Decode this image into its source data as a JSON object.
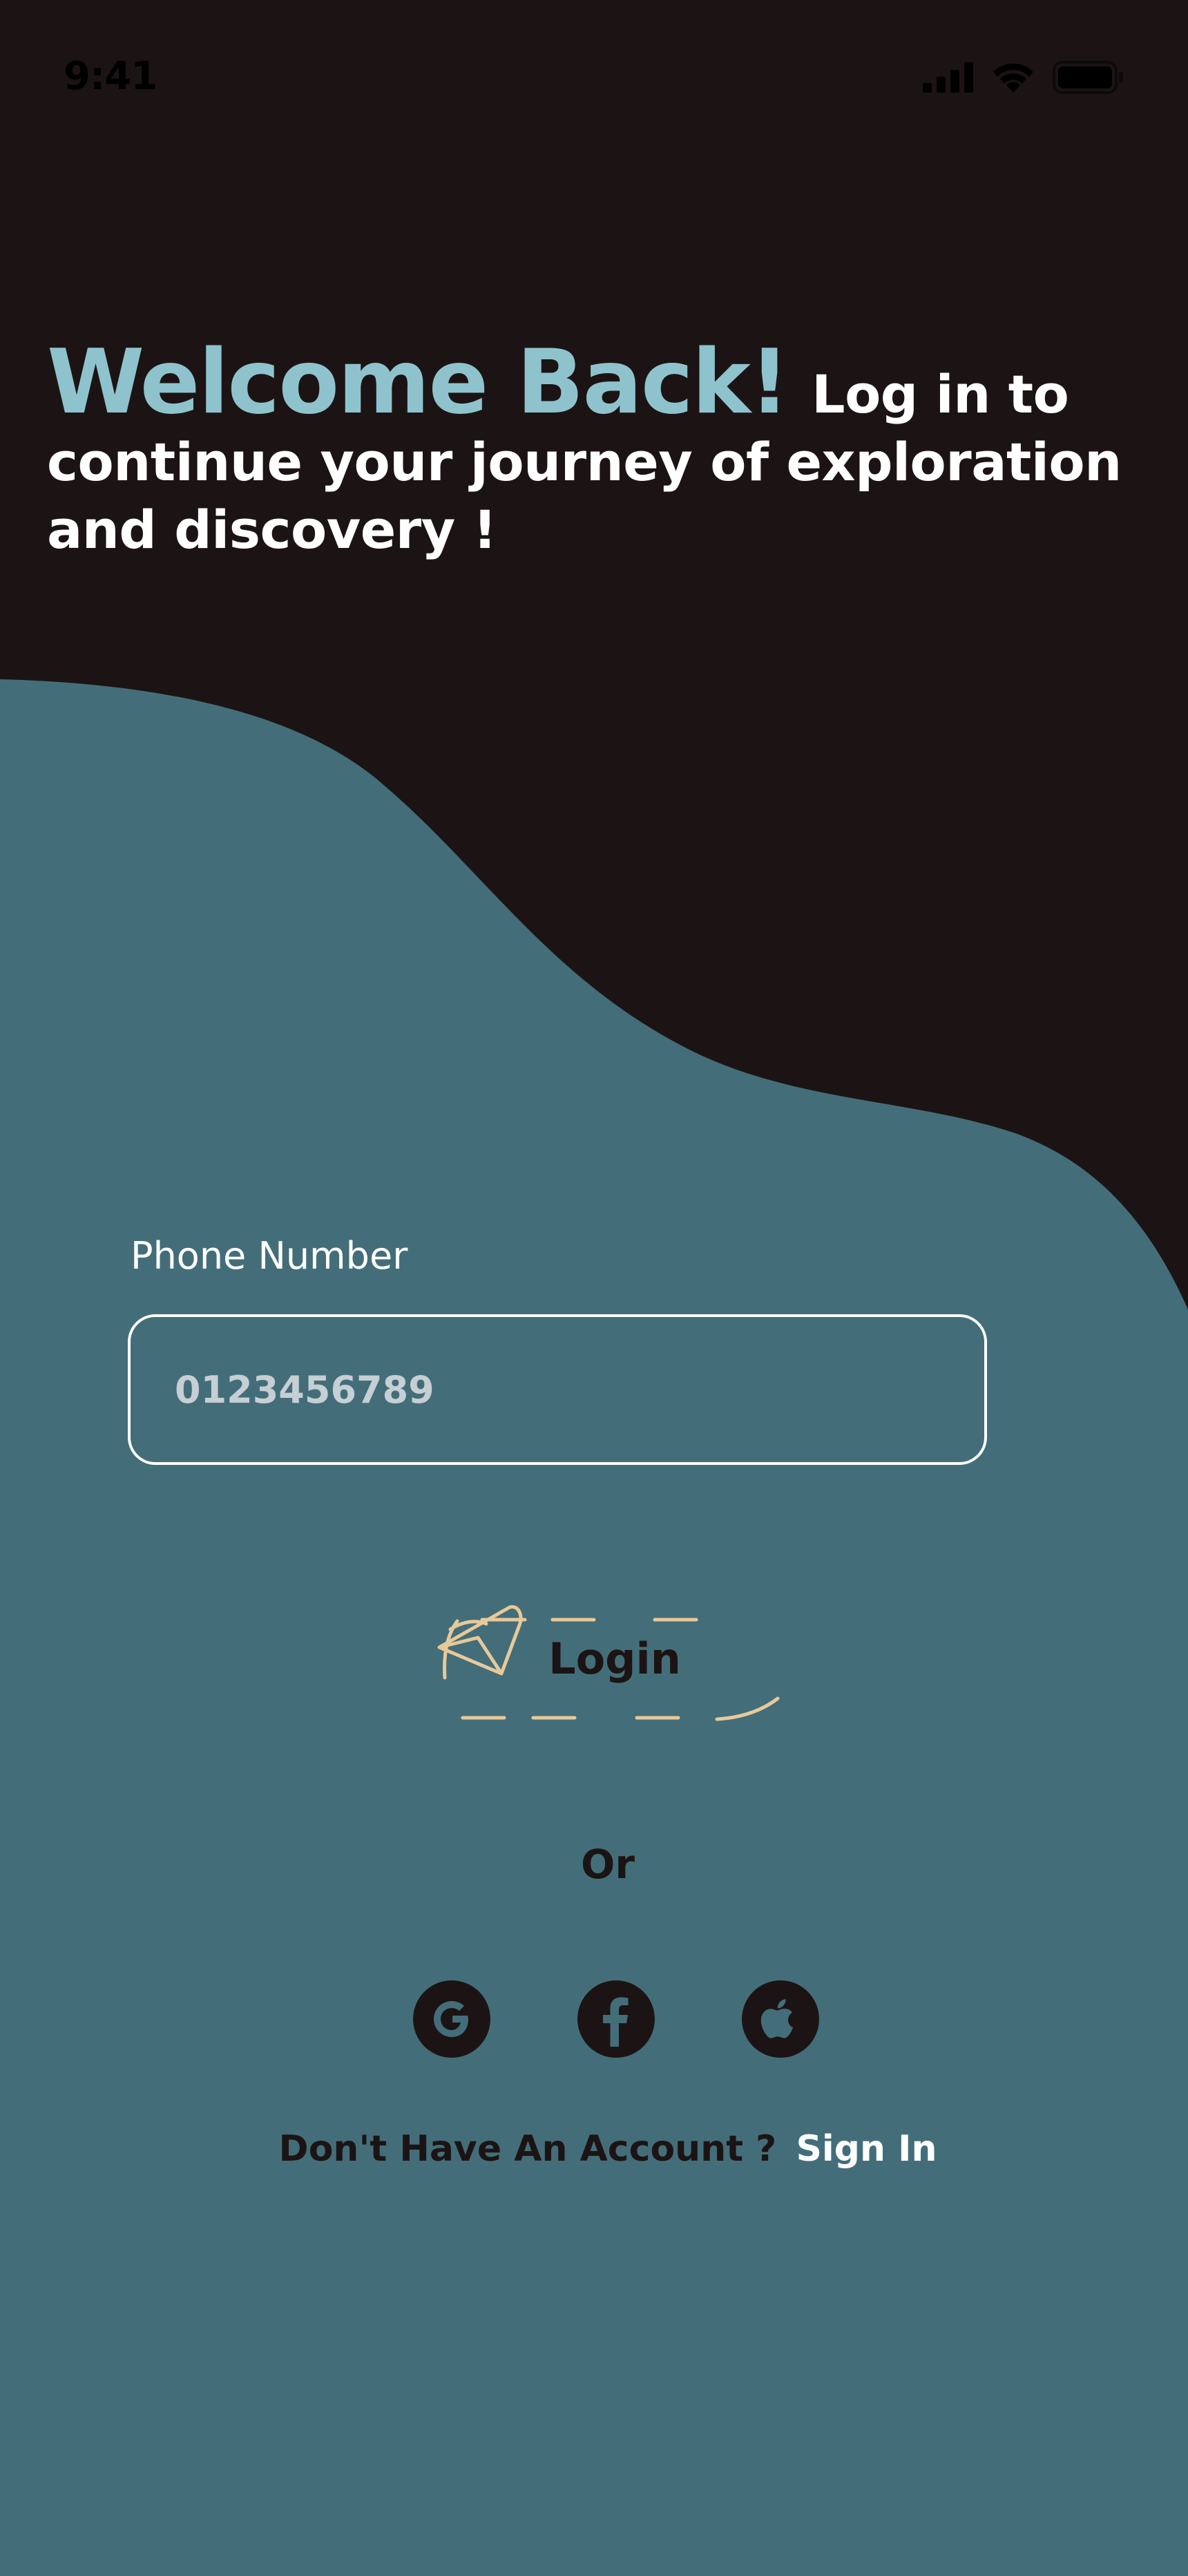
{
  "status_bar": {
    "time": "9:41",
    "icons": [
      "cellular-signal-icon",
      "wifi-icon",
      "battery-icon"
    ]
  },
  "header": {
    "accent_title": "Welcome Back!",
    "subtitle": "Log in to continue your journey of exploration and discovery !"
  },
  "form": {
    "phone_label": "Phone Number",
    "phone_value": "0123456789",
    "login_label": "Login"
  },
  "divider_text": "Or",
  "social": [
    "google-icon",
    "facebook-icon",
    "apple-icon"
  ],
  "footer": {
    "question": "Don't  Have An Account ?",
    "link": "Sign In"
  },
  "colors": {
    "background_dark": "#1c1414",
    "background_teal": "#436e79",
    "accent": "#8ec3cd",
    "login_outline": "#e8c99a"
  }
}
